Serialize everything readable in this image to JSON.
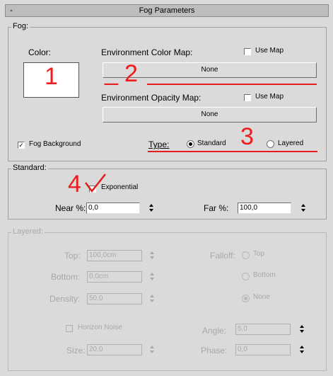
{
  "rollout": {
    "title": "Fog Parameters",
    "minus": "-"
  },
  "fog": {
    "group_label": "Fog:",
    "color_label": "Color:",
    "env_color_map_label": "Environment Color Map:",
    "env_color_use_map": "Use Map",
    "env_color_button": "None",
    "env_opacity_map_label": "Environment Opacity Map:",
    "env_opacity_use_map": "Use Map",
    "env_opacity_button": "None",
    "fog_background_label": "Fog Background",
    "type_label": "Type:",
    "type_standard": "Standard",
    "type_layered": "Layered"
  },
  "standard": {
    "group_label": "Standard:",
    "exponential_label": "Exponential",
    "near_label": "Near %:",
    "near_value": "0,0",
    "far_label": "Far %:",
    "far_value": "100,0"
  },
  "layered": {
    "group_label": "Layered:",
    "top_label": "Top:",
    "top_value": "100,0cm",
    "bottom_label": "Bottom:",
    "bottom_value": "0,0cm",
    "density_label": "Density:",
    "density_value": "50,0",
    "falloff_label": "Falloff:",
    "falloff_top": "Top",
    "falloff_bottom": "Bottom",
    "falloff_none": "None",
    "horizon_noise_label": "Horizon Noise",
    "size_label": "Size:",
    "size_value": "20,0",
    "angle_label": "Angle:",
    "angle_value": "5,0",
    "phase_label": "Phase:",
    "phase_value": "0,0"
  },
  "annotations": {
    "n1": "1",
    "n2": "2",
    "n3": "3",
    "n4": "4",
    "dash": "_"
  },
  "colors": {
    "annotation_red": "#ee1c1c",
    "color_swatch": "#ffffff"
  }
}
